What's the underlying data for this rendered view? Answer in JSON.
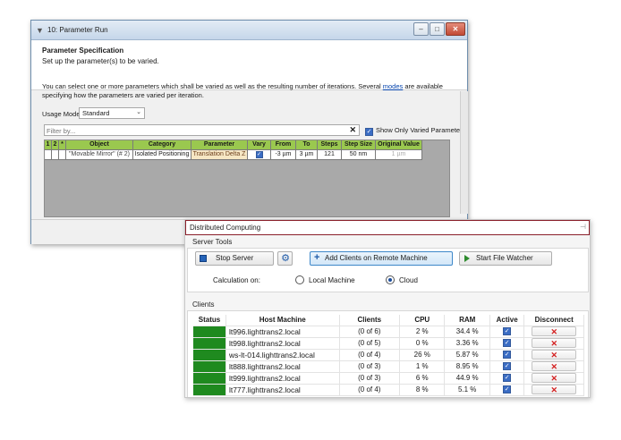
{
  "param_window": {
    "title": "10: Parameter Run",
    "heading": "Parameter Specification",
    "subheading": "Set up the parameter(s) to be varied.",
    "description_before_link": "You can select one or more parameters which shall be varied as well as the resulting number of iterations. Several ",
    "description_link": "modes",
    "description_after_link": " are available specifying how the parameters are varied per iteration.",
    "usage_mode_label": "Usage Mode",
    "usage_mode_value": "Standard",
    "filter_placeholder": "Filter by...",
    "show_only_varied_label": "Show Only Varied Parameters",
    "columns": [
      "1",
      "2",
      "*",
      "Object",
      "Category",
      "Parameter",
      "Vary",
      "From",
      "To",
      "Steps",
      "Step Size",
      "Original Value"
    ],
    "row": {
      "object": "\"Movable Mirror\" (# 2)",
      "category": "Isolated Positioning",
      "parameter": "Translation Delta Z",
      "vary": true,
      "from": "-3 µm",
      "to": "3 µm",
      "steps": "121",
      "step_size": "50 nm",
      "original_value": "1 µm"
    }
  },
  "dist_window": {
    "title": "Distributed Computing",
    "server_tools_label": "Server Tools",
    "stop_server_label": "Stop Server",
    "add_clients_label": "Add Clients on Remote Machine",
    "start_watcher_label": "Start File Watcher",
    "calc_on_label": "Calculation on:",
    "local_machine_label": "Local Machine",
    "cloud_label": "Cloud",
    "selected_calc": "Cloud",
    "clients_label": "Clients",
    "columns": [
      "Status",
      "Host Machine",
      "Clients",
      "CPU",
      "RAM",
      "Active",
      "Disconnect"
    ],
    "status_color": "#1f8a1f",
    "rows": [
      {
        "host": "lt996.lighttrans2.local",
        "clients": "(0 of 6)",
        "cpu": "2 %",
        "ram": "34.4 %",
        "active": true
      },
      {
        "host": "lt998.lighttrans2.local",
        "clients": "(0 of 5)",
        "cpu": "0 %",
        "ram": "3.36 %",
        "active": true
      },
      {
        "host": "ws-lt-014.lighttrans2.local",
        "clients": "(0 of 4)",
        "cpu": "26 %",
        "ram": "5.87 %",
        "active": true
      },
      {
        "host": "lt888.lighttrans2.local",
        "clients": "(0 of 3)",
        "cpu": "1 %",
        "ram": "8.95 %",
        "active": true
      },
      {
        "host": "lt999.lighttrans2.local",
        "clients": "(0 of 3)",
        "cpu": "6 %",
        "ram": "44.9 %",
        "active": true
      },
      {
        "host": "lt777.lighttrans2.local",
        "clients": "(0 of 4)",
        "cpu": "8 %",
        "ram": "5.1 %",
        "active": true
      }
    ]
  }
}
